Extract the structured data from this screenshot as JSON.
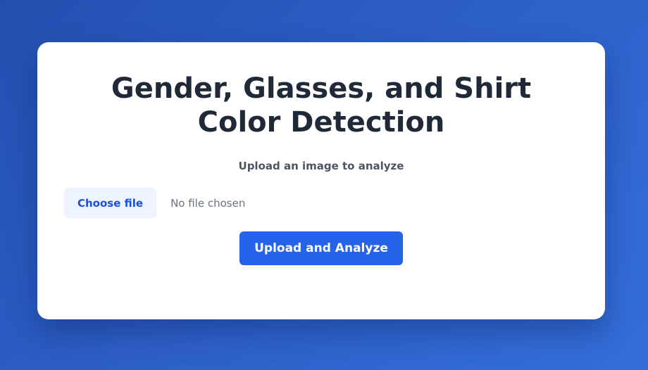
{
  "page": {
    "title": "Gender, Glasses, and Shirt Color Detection",
    "subtitle": "Upload an image to analyze"
  },
  "file_input": {
    "button_label": "Choose file",
    "status_text": "No file chosen"
  },
  "submit": {
    "label": "Upload and Analyze"
  },
  "colors": {
    "background": "#2d60c8",
    "card": "#ffffff",
    "title_text": "#1f2937",
    "primary_button": "#2563eb",
    "file_button_bg": "#eef4ff",
    "file_button_text": "#1d4ed8"
  }
}
